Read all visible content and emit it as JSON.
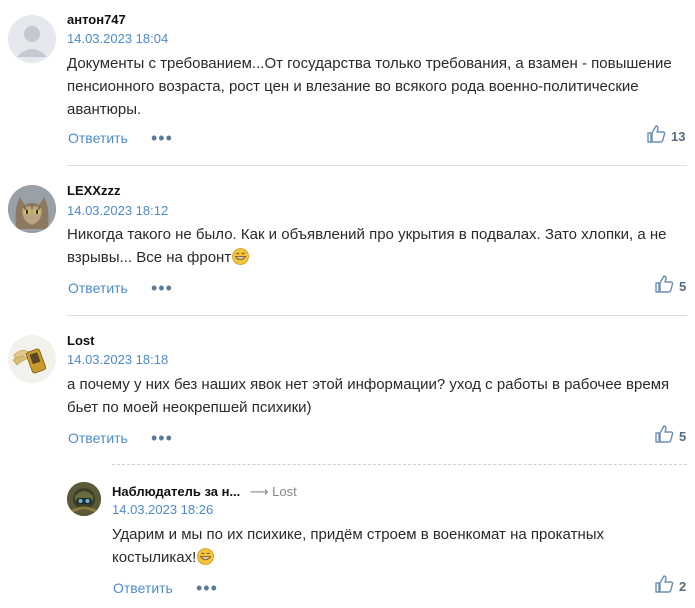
{
  "comments": [
    {
      "author": "антон747",
      "date": "14.03.2023 18:04",
      "text": "Документы с требованием...От государства только требования, а взамен - повышение пенсионного возраста, рост цен и влезание во всякого рода военно-политические авантюры.",
      "reply_label": "Ответить",
      "likes": "13"
    },
    {
      "author": "LEXXzzz",
      "date": "14.03.2023 18:12",
      "text": "Никогда такого не было. Как и объявлений про укрытия в подвалах. Зато хлопки, а не взрывы... Все на фронт",
      "reply_label": "Ответить",
      "likes": "5"
    },
    {
      "author": "Lost",
      "date": "14.03.2023 18:18",
      "text": "а почему у них без наших явок нет этой информации? уход с работы в рабочее время бьет по моей неокрепшей психики)",
      "reply_label": "Ответить",
      "likes": "5"
    },
    {
      "author": "Наблюдатель за н...",
      "reply_to": "⟶ Lost",
      "date": "14.03.2023 18:26",
      "text": "Ударим и мы по их психике, придём строем в военкомат на прокатных костыликах!",
      "reply_label": "Ответить",
      "likes": "2"
    }
  ],
  "icons": {
    "like": "thumbs-up-icon",
    "more": "more-dots-icon",
    "emoji": "grinning-emoji-icon"
  },
  "colors": {
    "link": "#4d8bc9",
    "date": "#4d8bc9",
    "like_icon": "#6a8fb5",
    "divider": "#dcdcdc"
  }
}
